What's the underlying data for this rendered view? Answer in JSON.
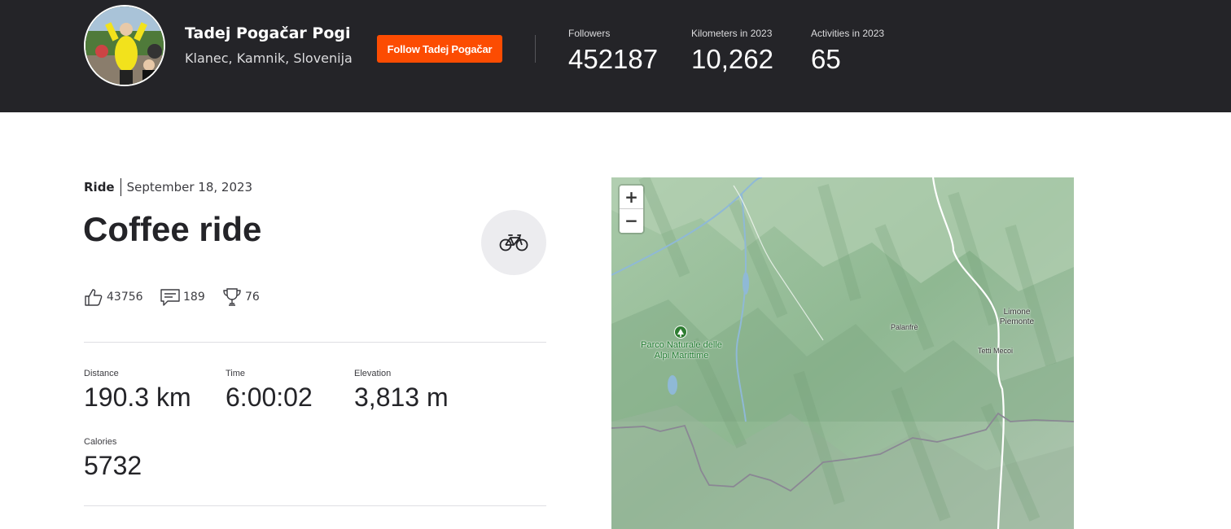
{
  "header": {
    "athlete_name": "Tadej Pogačar Pogi",
    "location": "Klanec, Kamnik, Slovenija",
    "follow_label": "Follow Tadej Pogačar",
    "accent_color": "#fc4c02",
    "stats": [
      {
        "label": "Followers",
        "value": "452187"
      },
      {
        "label": "Kilometers in 2023",
        "value": "10,262"
      },
      {
        "label": "Activities in 2023",
        "value": "65"
      }
    ]
  },
  "activity": {
    "type": "Ride",
    "date": "September 18, 2023",
    "title": "Coffee ride",
    "sport_icon": "bike-icon",
    "social": {
      "kudos": "43756",
      "comments": "189",
      "achievements": "76"
    },
    "stats": [
      {
        "label": "Distance",
        "value": "190.3 km"
      },
      {
        "label": "Time",
        "value": "6:00:02"
      },
      {
        "label": "Elevation",
        "value": "3,813 m"
      },
      {
        "label": "Calories",
        "value": "5732"
      }
    ]
  },
  "map": {
    "zoom_in": "+",
    "zoom_out": "−",
    "labels": {
      "park": "Parco Naturale delle Alpi Marittime",
      "palanfre": "Palanfrè",
      "limone": "Limone Piemonte",
      "tetti": "Tetti Mecoi"
    }
  }
}
